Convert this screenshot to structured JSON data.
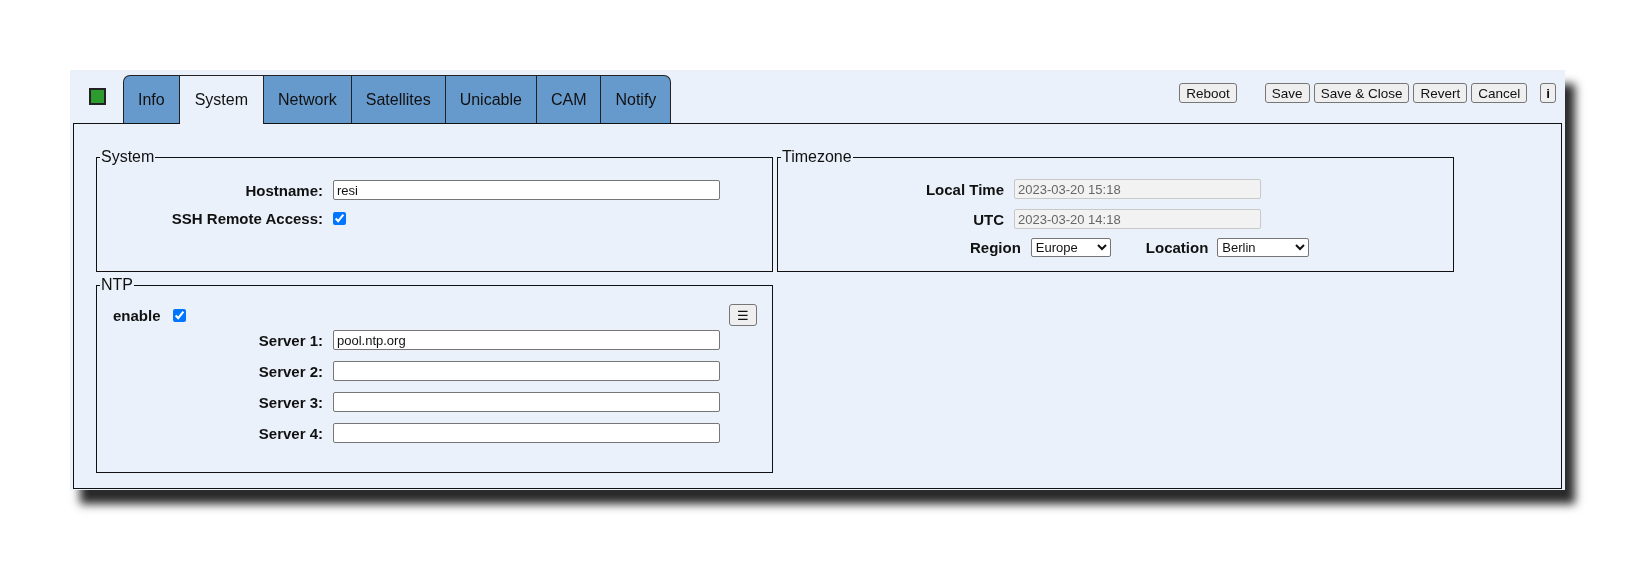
{
  "tabs": [
    {
      "label": "Info",
      "selected": false
    },
    {
      "label": "System",
      "selected": true
    },
    {
      "label": "Network",
      "selected": false
    },
    {
      "label": "Satellites",
      "selected": false
    },
    {
      "label": "Unicable",
      "selected": false
    },
    {
      "label": "CAM",
      "selected": false
    },
    {
      "label": "Notify",
      "selected": false
    }
  ],
  "reboot_button": "Reboot",
  "buttons": [
    "Save",
    "Save & Close",
    "Revert",
    "Cancel"
  ],
  "info_button": "i",
  "system": {
    "legend": "System",
    "hostname": {
      "label": "Hostname:",
      "value": "resi"
    },
    "ssh": {
      "label": "SSH Remote Access:",
      "checked": true
    }
  },
  "timezone": {
    "legend": "Timezone",
    "fields": [
      {
        "label": "Local Time",
        "value": "2023-03-20 15:18",
        "disabled": true
      },
      {
        "label": "UTC",
        "value": "2023-03-20 14:18",
        "disabled": true
      }
    ],
    "region": {
      "label": "Region",
      "value": "Europe"
    },
    "location": {
      "label": "Location",
      "value": "Berlin"
    }
  },
  "ntp": {
    "legend": "NTP",
    "enable": {
      "label": "enable",
      "checked": true
    },
    "menu_button": "☰",
    "servers": [
      {
        "label": "Server 1:",
        "value": "pool.ntp.org"
      },
      {
        "label": "Server 2:"
      },
      {
        "label": "Server 3:"
      },
      {
        "label": "Server 4:"
      }
    ]
  }
}
